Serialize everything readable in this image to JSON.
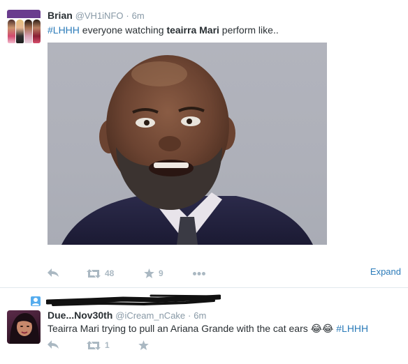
{
  "colors": {
    "link": "#2b7bb9",
    "muted": "#8899a6",
    "action_icon": "#aab8c2",
    "divider": "#e1e8ed"
  },
  "tweet1": {
    "name": "Brian",
    "handle": "@VH1iNFO",
    "separator": "·",
    "time": "6m",
    "avatar_logo_text": "LOVE & HIP HOP HOLLYWOOD",
    "text": {
      "hashtag": "#LHHH",
      "part1": " everyone watching ",
      "bold": "teairra Mari",
      "part2": " perform like.."
    },
    "actions": {
      "reply_icon": "reply-icon",
      "retweet_icon": "retweet-icon",
      "retweet_count": "48",
      "favorite_icon": "star-icon",
      "favorite_count": "9",
      "more_icon": "more-dots-icon",
      "expand_label": "Expand"
    }
  },
  "tweet2": {
    "name": "Due...Nov30th",
    "handle": "@iCream_nCake",
    "separator": "·",
    "time": "6m",
    "text": {
      "part1": "Teairra Mari trying to pull an Ariana Grande with the cat ears ",
      "emoji": "😂😂",
      "hashtag": "#LHHH"
    },
    "actions": {
      "reply_icon": "reply-icon",
      "retweet_icon": "retweet-icon",
      "retweet_count": "1",
      "favorite_icon": "star-icon"
    }
  }
}
